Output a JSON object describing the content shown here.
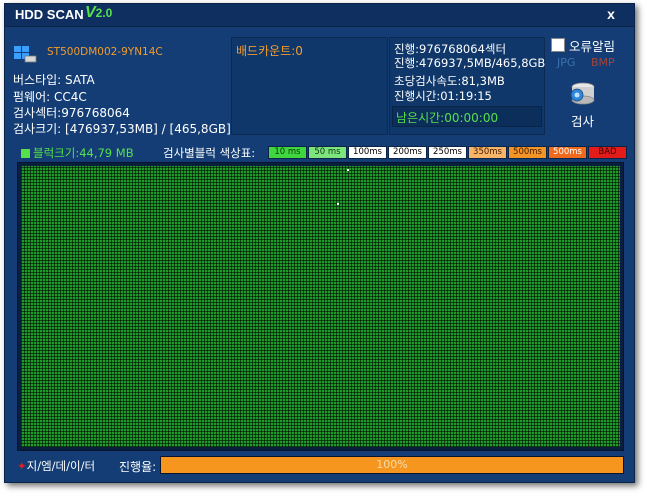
{
  "window": {
    "title": "HDD SCAN",
    "version_v": "V",
    "version_num": "2.0",
    "close_label": "x"
  },
  "drive": {
    "model": "ST500DM002-9YN14C",
    "bus_type": "버스타입: SATA",
    "firmware": "펌웨어: CC4C",
    "scan_sectors": "검사섹터:976768064",
    "scan_size": "검사크기: [476937,53MB] / [465,8GB]"
  },
  "bad_count": "배드카운트:0",
  "progress_info": {
    "sectors": "진행:976768064섹터",
    "size": "진행:476937,5MB/465,8GB",
    "speed": "초당검사속도:81,3MB",
    "elapsed": "진행시간:01:19:15",
    "remaining": "남은시간:00:00:00"
  },
  "options": {
    "error_alarm_label": "오류알림",
    "error_alarm_checked": false,
    "jpg_label": "JPG",
    "bmp_label": "BMP",
    "scan_label": "검사"
  },
  "block_size": "블럭크기:44,79 MB",
  "legend": {
    "title": "검사별블럭 색상표:",
    "items": [
      {
        "label": "10 ms",
        "bg": "#3fd63f",
        "fg": "#0a3a0a"
      },
      {
        "label": "50 ms",
        "bg": "#7ee57e",
        "fg": "#0a3a0a"
      },
      {
        "label": "100ms",
        "bg": "#ffffff",
        "fg": "#000000"
      },
      {
        "label": "200ms",
        "bg": "#ffffff",
        "fg": "#000000"
      },
      {
        "label": "250ms",
        "bg": "#ffffff",
        "fg": "#000000"
      },
      {
        "label": "350ms",
        "bg": "#f7b56a",
        "fg": "#4a2000"
      },
      {
        "label": "500ms",
        "bg": "#f39426",
        "fg": "#4a2000"
      },
      {
        "label": "500ms",
        "bg": "#f06a1e",
        "fg": "#ffffff"
      },
      {
        "label": "BAD",
        "bg": "#e21b1b",
        "fg": "#3a0000"
      }
    ]
  },
  "footer": {
    "brand": "지/엠/데/이/터",
    "progress_label": "진행율:",
    "progress_text": "100%",
    "progress_value": 100
  },
  "colors": {
    "window_bg": "#133d74",
    "block_ok": "#1d9b2a",
    "accent_orange": "#f39c2b",
    "accent_green": "#57e04c"
  }
}
